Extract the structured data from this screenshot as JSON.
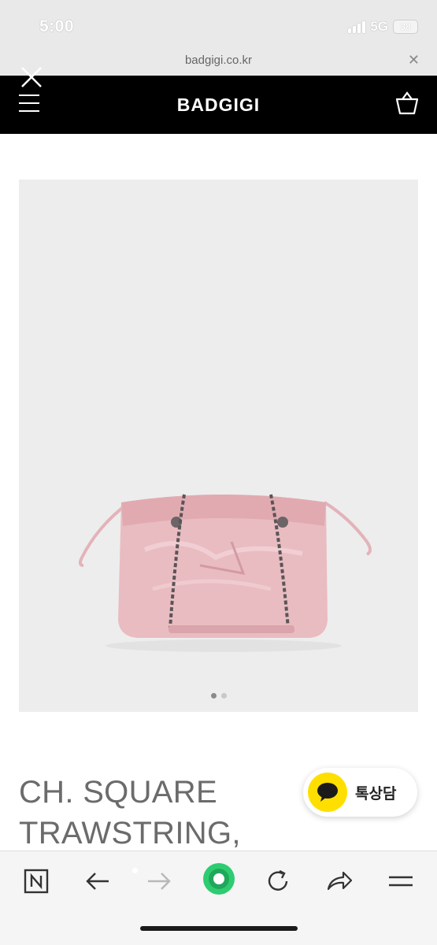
{
  "status_bar": {
    "time": "5:00",
    "network": "5G",
    "battery": "38"
  },
  "browser": {
    "url": "badgigi.co.kr"
  },
  "site": {
    "brand": "BADGIGI"
  },
  "product": {
    "title_line1": "CH. SQUARE",
    "title_line2": "TRAWSTRING, PINK",
    "image_count": 2,
    "active_image": 1
  },
  "chat": {
    "label": "톡상담"
  },
  "colors": {
    "header_bg": "#000000",
    "image_bg": "#ededed",
    "bag_pink": "#e9bcc1",
    "chat_yellow": "#ffdf00",
    "reload_green": "#2ecc71"
  },
  "toolbar_icons": [
    "naver-n-icon",
    "back-arrow-icon",
    "forward-arrow-icon",
    "green-home-icon",
    "reload-icon",
    "share-icon",
    "menu-lines-icon"
  ]
}
